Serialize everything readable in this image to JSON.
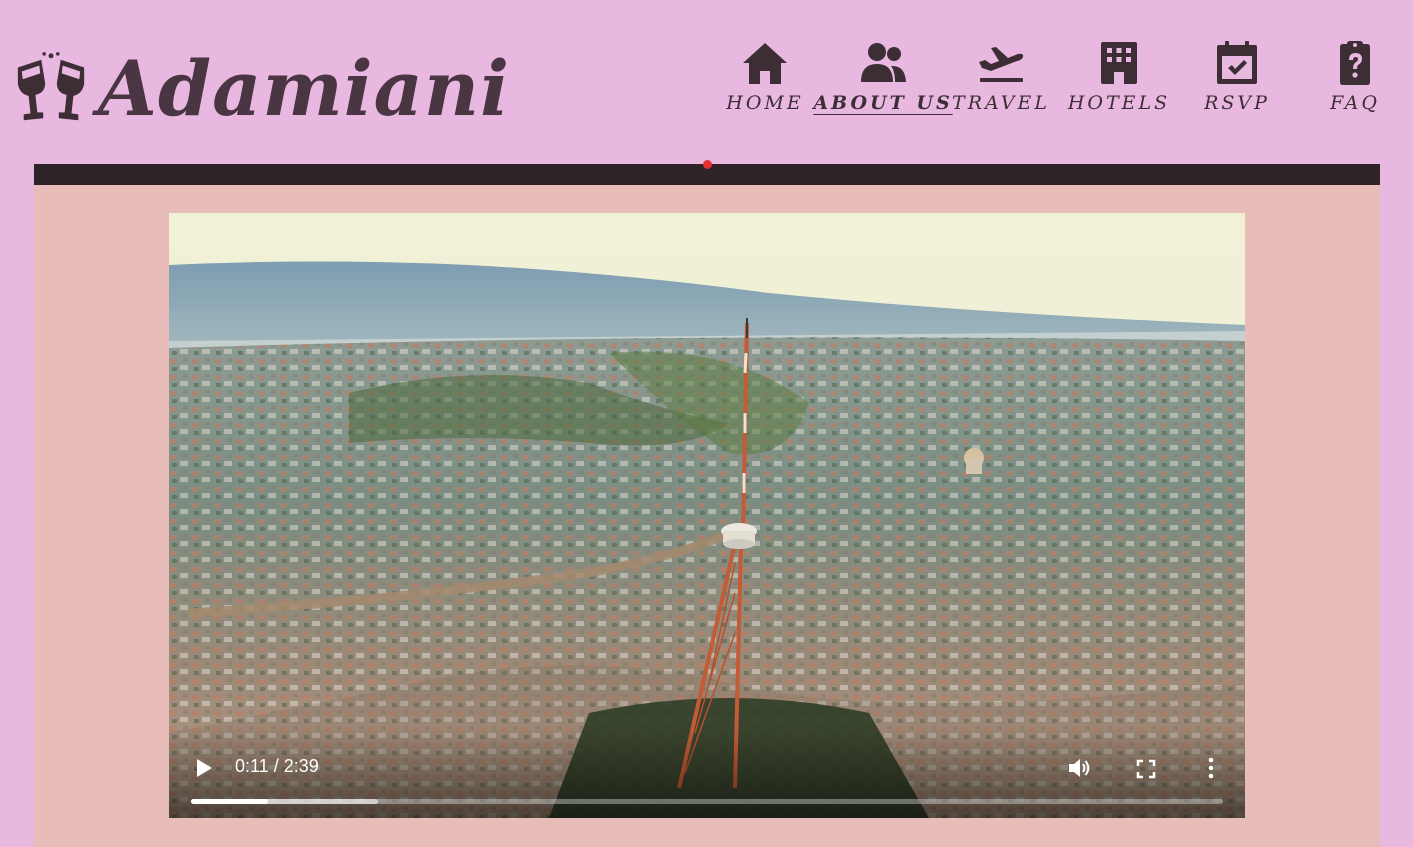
{
  "brand": {
    "name": "Adamiani",
    "logo_icon": "cheers-glasses-icon"
  },
  "nav": [
    {
      "label": "HOME",
      "icon": "house-icon",
      "active": false
    },
    {
      "label": "ABOUT US",
      "icon": "users-icon",
      "active": true
    },
    {
      "label": "TRAVEL",
      "icon": "plane-icon",
      "active": false
    },
    {
      "label": "HOTELS",
      "icon": "hotel-icon",
      "active": false
    },
    {
      "label": "RSVP",
      "icon": "calendar-check-icon",
      "active": false
    },
    {
      "label": "FAQ",
      "icon": "clipboard-question-icon",
      "active": false
    }
  ],
  "video": {
    "time_display": "0:11 / 2:39",
    "played_fraction": 0.075,
    "buffered_fraction": 0.181
  },
  "colors": {
    "background": "#e8b8e0",
    "panel": "#e8bdb9",
    "text": "#3d2e36",
    "bar": "#2e2428"
  }
}
